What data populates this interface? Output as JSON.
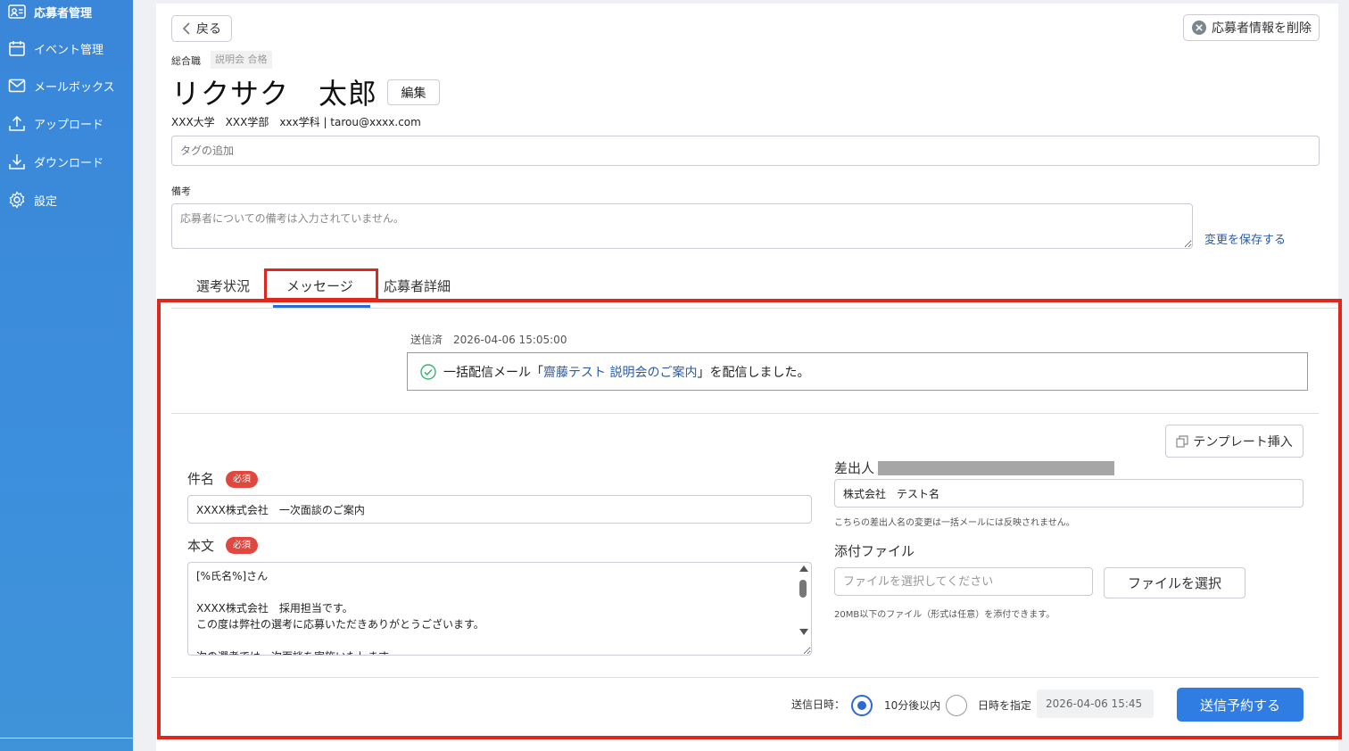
{
  "sidebar": {
    "items": [
      {
        "label": "応募者管理",
        "icon": "applicant-card-icon"
      },
      {
        "label": "イベント管理",
        "icon": "calendar-icon"
      },
      {
        "label": "メールボックス",
        "icon": "mail-icon"
      },
      {
        "label": "アップロード",
        "icon": "upload-icon"
      },
      {
        "label": "ダウンロード",
        "icon": "download-icon"
      },
      {
        "label": "設定",
        "icon": "gear-icon"
      }
    ]
  },
  "header": {
    "back_label": "戻る",
    "delete_label": "応募者情報を削除"
  },
  "applicant": {
    "job_type": "総合職",
    "status": "説明会 合格",
    "name": "リクサク　太郎",
    "edit_label": "編集",
    "info": "XXX大学　XXX学部　xxx学科 | tarou@xxxx.com"
  },
  "tags": {
    "placeholder": "タグの追加"
  },
  "memo": {
    "label": "備考",
    "placeholder": "応募者についての備考は入力されていません。",
    "save_label": "変更を保存する"
  },
  "tabs": [
    {
      "label": "選考状況"
    },
    {
      "label": "メッセージ",
      "active": true
    },
    {
      "label": "応募者詳細"
    }
  ],
  "message": {
    "sent_meta": "送信済　2026-04-06 15:05:00",
    "sent_prefix": "一括配信メール「",
    "sent_link": "齋藤テスト 説明会のご案内",
    "sent_suffix": "」を配信しました。"
  },
  "compose": {
    "template_label": "テンプレート挿入",
    "subject_label": "件名",
    "required_label": "必須",
    "subject_value": "XXXX株式会社　一次面談のご案内",
    "body_label": "本文",
    "body_value": "[%氏名%]さん\n\nXXXX株式会社　採用担当です。\nこの度は弊社の選考に応募いただきありがとうございます。\n\n次の選考では一次面談を実施いたします。",
    "sender_label": "差出人",
    "sender_value": "株式会社　テスト名",
    "sender_hint": "こちらの差出人名の変更は一括メールには反映されません。",
    "attach_label": "添付ファイル",
    "attach_placeholder": "ファイルを選択してください",
    "attach_button": "ファイルを選択",
    "attach_hint": "20MB以下のファイル（形式は任意）を添付できます。",
    "send_time_label": "送信日時：",
    "option_soon": "10分後以内",
    "option_specify": "日時を指定",
    "datetime_value": "2026-04-06 15:45",
    "send_button": "送信予約する"
  },
  "colors": {
    "sidebar": "#3a86d9",
    "accent": "#2f7de3",
    "highlight": "#e0271e",
    "required": "#e0483f",
    "link": "#2a5aa8"
  }
}
